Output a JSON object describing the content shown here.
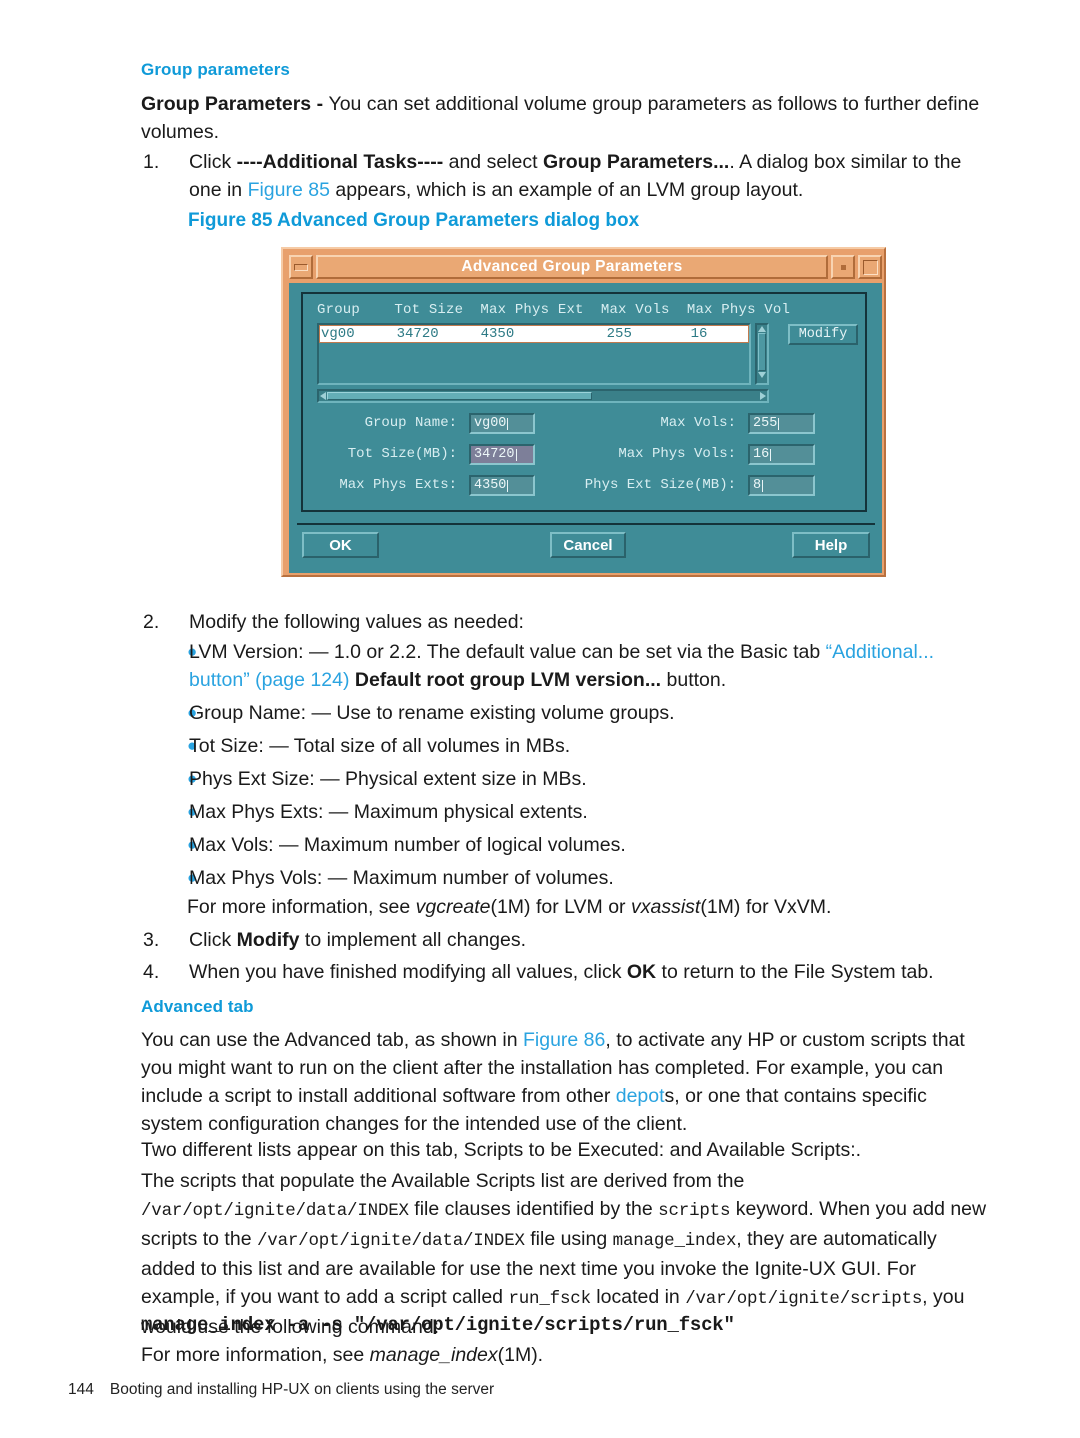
{
  "section": {
    "heading": "Group parameters",
    "intro_bold": "Group Parameters - ",
    "intro_rest": "You can set additional volume group parameters as follows to further define volumes."
  },
  "steps": [
    {
      "num": "1.",
      "pre": "Click ",
      "b1": "----Additional Tasks----",
      "mid": " and select ",
      "b2": "Group Parameters...",
      "post1": ". A dialog box similar to the one in ",
      "link": "Figure 85",
      "post2": " appears, which is an example of an LVM group layout."
    },
    {
      "num": "2.",
      "text": "Modify the following values as needed:"
    },
    {
      "num": "3.",
      "pre": "Click ",
      "b1": "Modify",
      "post1": " to implement all changes."
    },
    {
      "num": "4.",
      "pre": "When you have finished modifying all values, click ",
      "b1": "OK",
      "post1": " to return to the File System tab."
    }
  ],
  "figure": {
    "caption": "Figure 85 Advanced Group Parameters dialog box"
  },
  "dialog": {
    "title": "Advanced Group Parameters",
    "titlebar_icons": {
      "minimize": "minimize-icon",
      "restore": "restore-icon",
      "maximize": "maximize-icon"
    },
    "table": {
      "columns_raw": "Group    Tot Size  Max Phys Ext  Max Vols  Max Phys Vol",
      "columns": [
        "Group",
        "Tot Size",
        "Max Phys Ext",
        "Max Vols",
        "Max Phys Vol"
      ],
      "rows": [
        {
          "raw": "vg00     34720     4350           255       16",
          "cells": [
            "vg00",
            "34720",
            "4350",
            "255",
            "16"
          ]
        }
      ]
    },
    "modify_button": "Modify",
    "fields": [
      {
        "label": "Group Name:",
        "value": "vg00",
        "highlighted": false
      },
      {
        "label": "Max Vols:",
        "value": "255",
        "highlighted": false
      },
      {
        "label": "Tot Size(MB):",
        "value": "34720",
        "highlighted": true
      },
      {
        "label": "Max Phys Vols:",
        "value": "16",
        "highlighted": false
      },
      {
        "label": "Max Phys Exts:",
        "value": "4350",
        "highlighted": false
      },
      {
        "label": "Phys Ext Size(MB):",
        "value": "8",
        "highlighted": false
      }
    ],
    "buttons": {
      "ok": "OK",
      "cancel": "Cancel",
      "help": "Help"
    },
    "colors": {
      "title_bar": "#eaa874",
      "frame": "#e8a06c",
      "body": "#3f8c97",
      "selected_row_bg": "#ffffff",
      "highlight_field": "#7d7f99"
    }
  },
  "bullets_step2": [
    {
      "pre": "LVM Version: — 1.0 or 2.2. The default value can be set via the Basic tab ",
      "link": "“Additional... button” (page 124)",
      "bold": " Default root group LVM version...",
      "post": " button."
    },
    {
      "plain": "Group Name: — Use to rename existing volume groups."
    },
    {
      "plain": "Tot Size: — Total size of all volumes in MBs."
    },
    {
      "plain": "Phys Ext Size: — Physical extent size in MBs."
    },
    {
      "plain": "Max Phys Exts: — Maximum physical extents."
    },
    {
      "plain": "Max Vols: — Maximum number of logical volumes."
    },
    {
      "plain": "Max Phys Vols: — Maximum number of volumes."
    }
  ],
  "more_info_line": {
    "pre": "For more information, see ",
    "ital1": "vgcreate",
    "mid1": "(1M) for LVM or ",
    "ital2": "vxassist",
    "post": "(1M) for VxVM."
  },
  "advanced": {
    "heading": "Advanced tab",
    "para1_a": "You can use the Advanced tab, as shown in ",
    "para1_link": "Figure 86",
    "para1_b": ", to activate any HP or custom scripts that you might want to run on the client after the installation has completed. For example, you can include a script to install additional software from other ",
    "para1_link2": "depot",
    "para1_c": "s, or one that contains specific system configuration changes for the intended use of the client.",
    "para2": "Two different lists appear on this tab, Scripts to be Executed: and Available Scripts:.",
    "para3_a": "The scripts that populate the Available Scripts list are derived from the ",
    "para3_m1": "/var/opt/ignite/data/INDEX",
    "para3_b": " file clauses identified by the ",
    "para3_m2": "scripts",
    "para3_c": " keyword. When you add new scripts to the ",
    "para3_m3": "/var/opt/ignite/data/INDEX",
    "para3_d": " file using ",
    "para3_m4": "manage_index",
    "para3_e": ", they are automatically added to this list and are available for use the next time you invoke the Ignite-UX GUI. For example, if you want to add a script called ",
    "para3_m5": "run_fsck",
    "para3_f": " located in ",
    "para3_m6": "/var/opt/ignite/scripts",
    "para3_g": ", you would use the following command:",
    "command": "manage_index -a -s \"/var/opt/ignite/scripts/run_fsck\"",
    "closing_pre": "For more information, see ",
    "closing_ital": "manage_index",
    "closing_post": "(1M)."
  },
  "footer": {
    "page_number": "144",
    "running_head": "Booting and installing HP-UX on clients using the server"
  }
}
